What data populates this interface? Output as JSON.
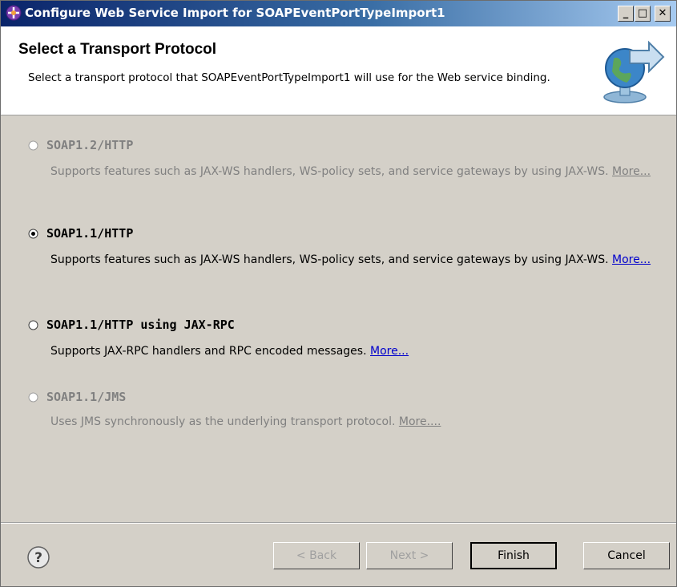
{
  "window": {
    "title": "Configure Web Service Import for SOAPEventPortTypeImport1",
    "controls": {
      "minimize": "_",
      "maximize": "□",
      "close": "✕"
    }
  },
  "header": {
    "title": "Select a Transport Protocol",
    "description": "Select a transport protocol that SOAPEventPortTypeImport1 will use for the Web service binding.",
    "graphic_icon": "globe-arrow-icon"
  },
  "options": [
    {
      "label": "SOAP1.2/HTTP",
      "description": "Supports features such as JAX-WS handlers, WS-policy sets, and service gateways by using JAX-WS.",
      "more": "More...",
      "selected": false,
      "enabled": false
    },
    {
      "label": "SOAP1.1/HTTP",
      "description": "Supports features such as JAX-WS handlers, WS-policy sets, and service gateways by using JAX-WS.",
      "more": "More...",
      "selected": true,
      "enabled": true
    },
    {
      "label": "SOAP1.1/HTTP using JAX-RPC",
      "description": "Supports JAX-RPC handlers and RPC encoded messages.",
      "more": "More...",
      "selected": false,
      "enabled": true
    },
    {
      "label": "SOAP1.1/JMS",
      "description": "Uses JMS synchronously as the underlying transport protocol.",
      "more": "More....",
      "selected": false,
      "enabled": false
    }
  ],
  "footer": {
    "help_icon": "help-icon",
    "buttons": {
      "back": "< Back",
      "next": "Next >",
      "finish": "Finish",
      "cancel": "Cancel"
    }
  },
  "colors": {
    "titlebar_start": "#0a246a",
    "titlebar_end": "#a6caf0",
    "dialog_bg": "#d4d0c8",
    "link": "#0000cc",
    "disabled_text": "#808080"
  }
}
